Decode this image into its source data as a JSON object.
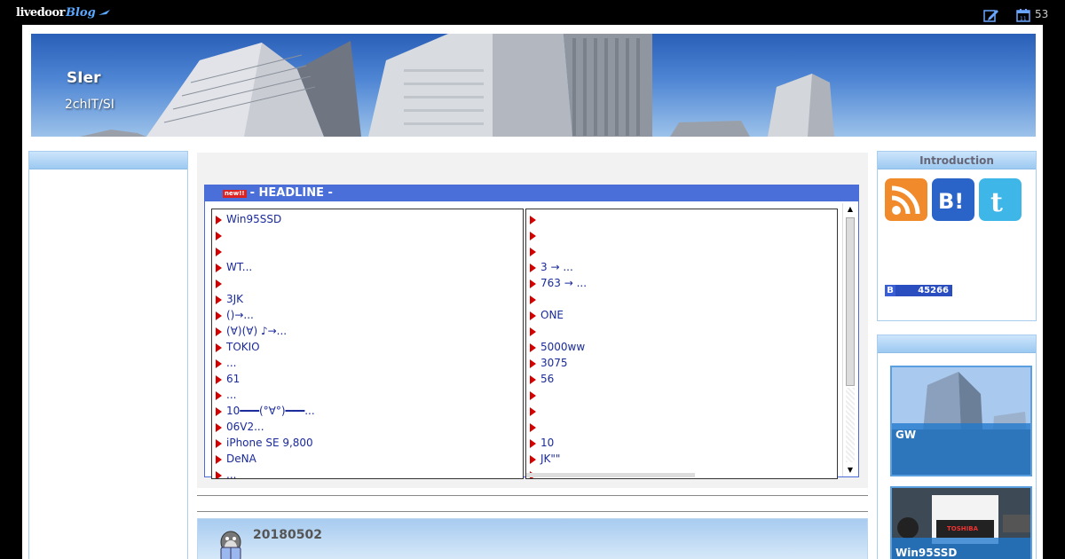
{
  "topbar": {
    "logo_main": "livedoor",
    "logo_blog": "Blog",
    "count": "53"
  },
  "header": {
    "title": "SIer",
    "description": "2chIT/SI"
  },
  "left_box": {
    "title": ""
  },
  "headline": {
    "new_badge": "new!!",
    "title": "- HEADLINE -",
    "left_items": [
      "Win95SSD",
      "",
      "",
      "WT...",
      "",
      "3JK",
      "()→...",
      "(∀)(∀) ♪→...",
      "TOKIO",
      "...",
      " 61",
      "...",
      "10━━━(°∀°)━━━...",
      " 06V2...",
      "iPhone SE  9,800",
      "DeNA",
      "..."
    ],
    "right_items": [
      "",
      "",
      "",
      "3 →  ...",
      "763 → ...",
      "",
      "ONE",
      "",
      "5000ww",
      "3075",
      "56",
      "",
      "",
      "",
      "10",
      "JK\"\"",
      ""
    ]
  },
  "entry": {
    "date": "20180502"
  },
  "right_intro": {
    "title": "Introduction",
    "hatena_label": "B",
    "hatena_count": "45266"
  },
  "right_pickup": {
    "title": "",
    "items": [
      {
        "label": "GW"
      },
      {
        "label": "Win95SSD"
      }
    ]
  },
  "colors": {
    "headline_bar": "#4a6fd8",
    "link": "#1a2a9a",
    "bullet": "#d40000",
    "sidebox_border": "#a9cdee"
  }
}
